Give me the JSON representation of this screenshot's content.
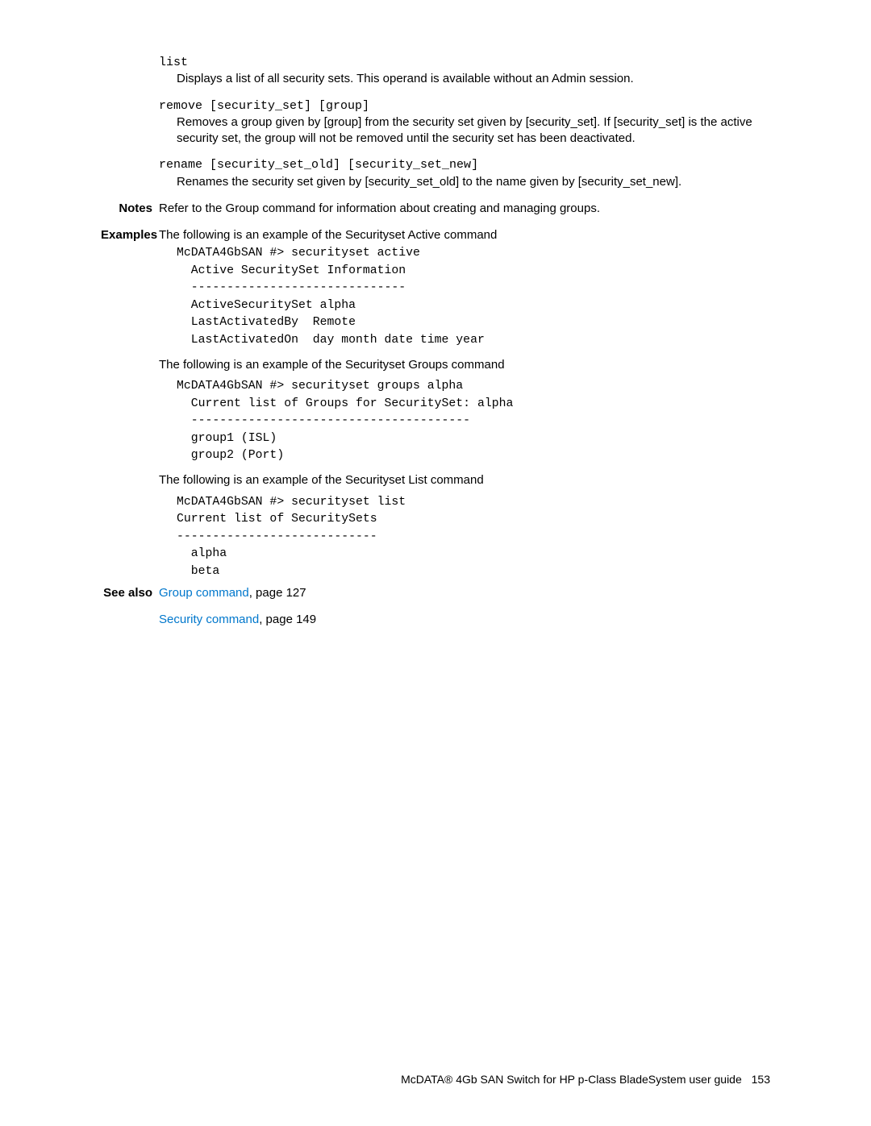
{
  "operands": {
    "list": {
      "term": "list",
      "desc": "Displays a list of all security sets. This operand is available without an Admin session."
    },
    "remove": {
      "term": "remove [security_set] [group]",
      "desc": "Removes a group given by [group] from the security set given by [security_set]. If [security_set] is the active security set, the group will not be removed until the security set has been deactivated."
    },
    "rename": {
      "term": "rename [security_set_old] [security_set_new]",
      "desc": "Renames the security set given by [security_set_old] to the name given by [security_set_new]."
    }
  },
  "notes": {
    "label": "Notes",
    "text": "Refer to the Group command for information about creating and managing groups."
  },
  "examples": {
    "label": "Examples",
    "intro1": "The following is an example of the Securityset Active command",
    "code1": "McDATA4GbSAN #> securityset active\n  Active SecuritySet Information\n  ------------------------------\n  ActiveSecuritySet alpha\n  LastActivatedBy  Remote\n  LastActivatedOn  day month date time year",
    "intro2": "The following is an example of the Securityset Groups command",
    "code2": "McDATA4GbSAN #> securityset groups alpha\n  Current list of Groups for SecuritySet: alpha\n  ---------------------------------------\n  group1 (ISL)\n  group2 (Port)",
    "intro3": "The following is an example of the Securityset List command",
    "code3": "McDATA4GbSAN #> securityset list\nCurrent list of SecuritySets\n----------------------------\n  alpha\n  beta"
  },
  "see_also": {
    "label": "See also",
    "link1": "Group command",
    "link1_suffix": ", page 127",
    "link2": "Security command",
    "link2_suffix": ", page 149"
  },
  "footer": {
    "text": "McDATA® 4Gb SAN Switch for HP p-Class BladeSystem user guide",
    "page": "153"
  }
}
